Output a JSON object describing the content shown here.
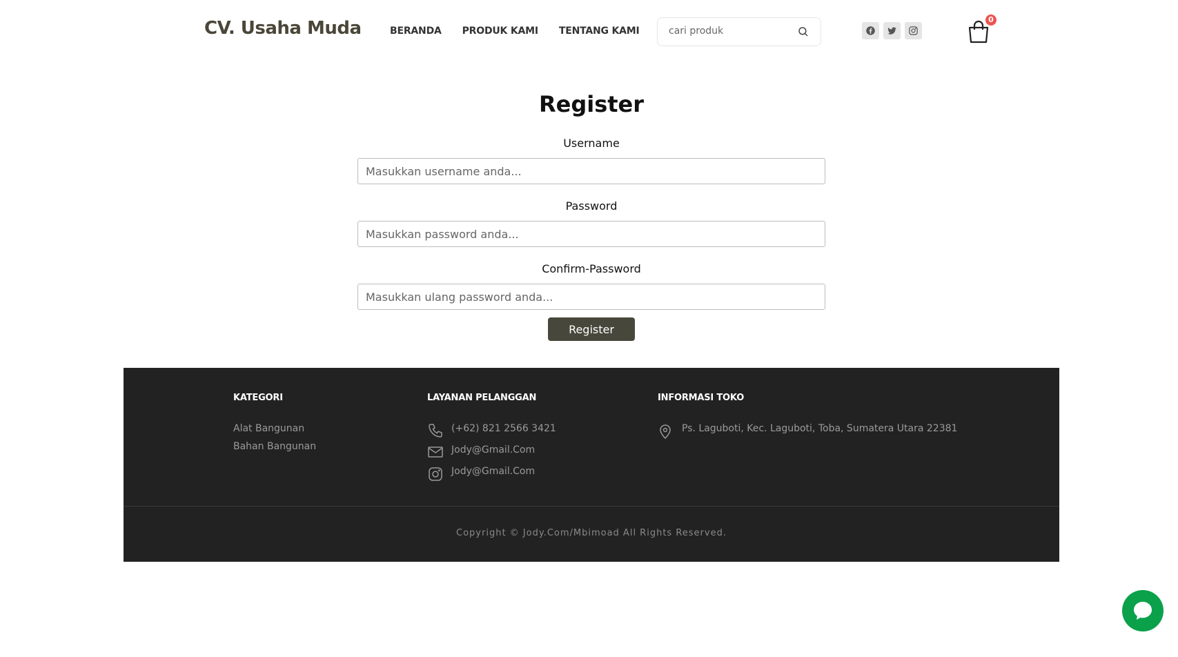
{
  "header": {
    "brand": "CV. Usaha Muda",
    "nav": [
      "BERANDA",
      "PRODUK KAMI",
      "TENTANG KAMI"
    ],
    "search": {
      "placeholder": "cari produk"
    },
    "socials": [
      "facebook-icon",
      "twitter-icon",
      "instagram-icon"
    ],
    "cart": {
      "icon": "shopping-bag-icon",
      "count": "0"
    }
  },
  "form": {
    "title": "Register",
    "username": {
      "label": "Username",
      "placeholder": "Masukkan username anda..."
    },
    "password": {
      "label": "Password",
      "placeholder": "Masukkan password anda..."
    },
    "confirm": {
      "label": "Confirm-Password",
      "placeholder": "Masukkan ulang password anda..."
    },
    "submit_label": "Register"
  },
  "footer": {
    "kategori": {
      "title": "KATEGORI",
      "items": [
        "Alat Bangunan",
        "Bahan Bangunan"
      ]
    },
    "layanan": {
      "title": "LAYANAN PELANGGAN",
      "phone": "(+62) 821 2566 3421",
      "email": "Jody@Gmail.Com",
      "instagram": "Jody@Gmail.Com"
    },
    "informasi": {
      "title": "INFORMASI TOKO",
      "address": "Ps. Laguboti, Kec. Laguboti, Toba, Sumatera Utara 22381"
    },
    "copyright": "Copyright © Jody.Com/Mbimoad All Rights Reserved."
  },
  "colors": {
    "brand": "#4a4739",
    "button": "#48473b",
    "footer_bg": "#222222",
    "badge": "#ef5350",
    "chat": "#0aa14a"
  }
}
